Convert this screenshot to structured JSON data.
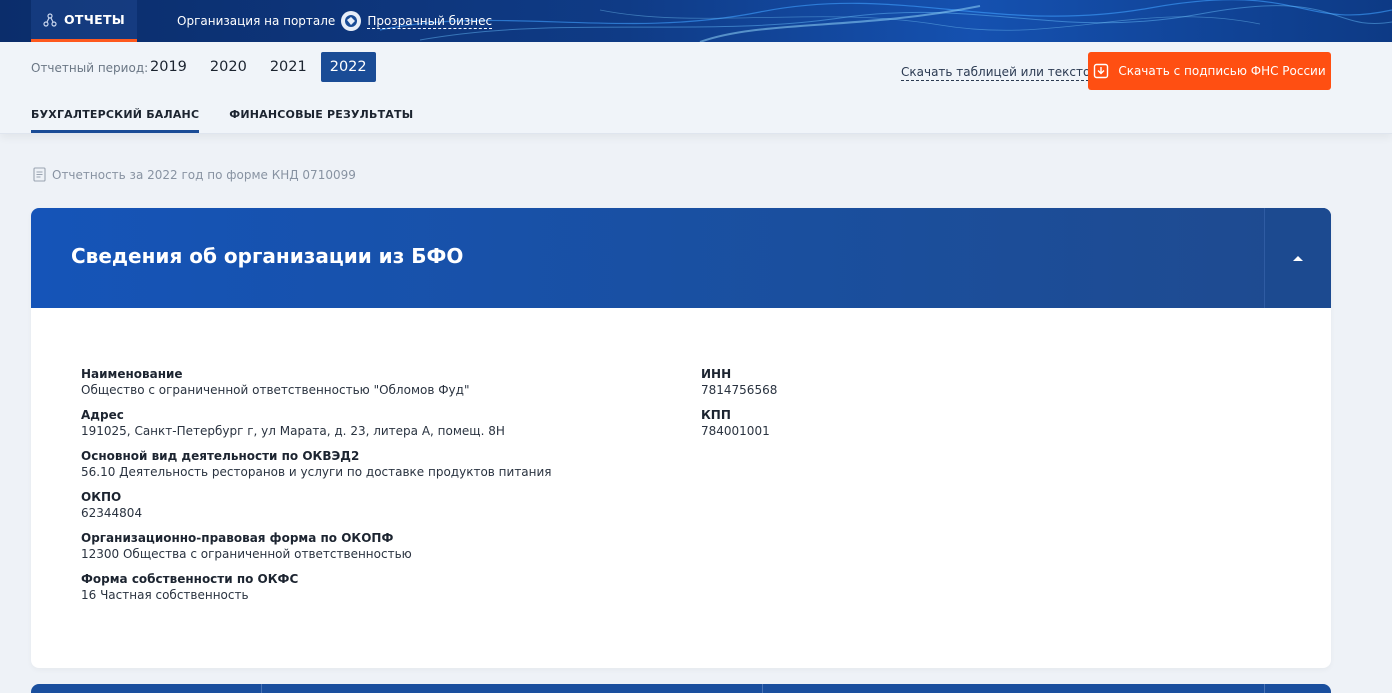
{
  "topbar": {
    "reports_tab": "ОТЧЕТЫ",
    "portal_text": "Организация на портале",
    "portal_link": "Прозрачный бизнес"
  },
  "period": {
    "label": "Отчетный период:",
    "years": [
      "2019",
      "2020",
      "2021",
      "2022"
    ],
    "selected": "2022",
    "download_text_link": "Скачать таблицей или текстом",
    "download_button": "Скачать с подписью ФНС России"
  },
  "subtabs": [
    "БУХГАЛТЕРСКИЙ БАЛАНС",
    "ФИНАНСОВЫЕ РЕЗУЛЬТАТЫ"
  ],
  "report_form": "Отчетность за 2022 год по форме КНД 0710099",
  "card": {
    "title": "Сведения об организации из БФО",
    "left_fields": [
      {
        "label": "Наименование",
        "value": "Общество с ограниченной ответственностью \"Обломов Фуд\""
      },
      {
        "label": "Адрес",
        "value": "191025, Санкт-Петербург г, ул Марата, д. 23, литера А, помещ. 8Н"
      },
      {
        "label": "Основной вид деятельности по ОКВЭД2",
        "value": "56.10 Деятельность ресторанов и услуги по доставке продуктов питания"
      },
      {
        "label": "ОКПО",
        "value": "62344804"
      },
      {
        "label": "Организационно-правовая форма по ОКОПФ",
        "value": "12300 Общества с ограниченной ответственностью"
      },
      {
        "label": "Форма собственности по ОКФС",
        "value": "16 Частная собственность"
      }
    ],
    "right_fields": [
      {
        "label": "ИНН",
        "value": "7814756568"
      },
      {
        "label": "КПП",
        "value": "784001001"
      }
    ]
  },
  "colors": {
    "accent_orange": "#ff4f12",
    "primary_blue": "#1a4c96"
  },
  "icons": {
    "reports": "network-icon",
    "portal": "globe-icon",
    "download": "download-icon",
    "document": "document-icon",
    "collapse": "chevron-up-icon"
  }
}
